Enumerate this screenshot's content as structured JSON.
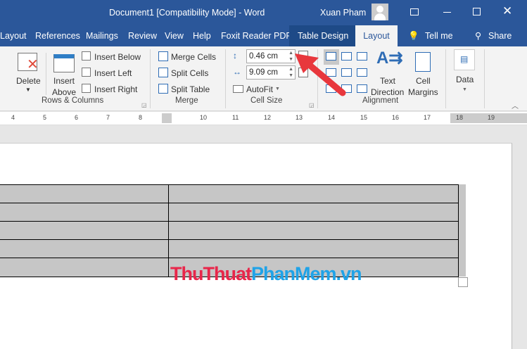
{
  "window": {
    "title": "Document1 [Compatibility Mode]  -  Word",
    "user": "Xuan Pham"
  },
  "tabs": [
    "Layout",
    "References",
    "Mailings",
    "Review",
    "View",
    "Help",
    "Foxit Reader PDF",
    "Table Design",
    "Layout",
    "Tell me",
    "Share"
  ],
  "ribbon": {
    "rows_columns": {
      "delete": "Delete",
      "insert_above_1": "Insert",
      "insert_above_2": "Above",
      "insert_below": "Insert Below",
      "insert_left": "Insert Left",
      "insert_right": "Insert Right",
      "label": "Rows & Columns"
    },
    "merge": {
      "merge_cells": "Merge Cells",
      "split_cells": "Split Cells",
      "split_table": "Split Table",
      "label": "Merge"
    },
    "cell_size": {
      "height": "0.46 cm",
      "width": "9.09 cm",
      "autofit": "AutoFit",
      "label": "Cell Size"
    },
    "alignment": {
      "text_direction_1": "Text",
      "text_direction_2": "Direction",
      "cell_margins_1": "Cell",
      "cell_margins_2": "Margins",
      "label": "Alignment"
    },
    "data": {
      "label": "Data"
    }
  },
  "ruler": [
    "4",
    "5",
    "6",
    "7",
    "8",
    "10",
    "11",
    "12",
    "13",
    "14",
    "15",
    "16",
    "17",
    "18",
    "19"
  ],
  "watermark": {
    "part1": "ThuThuat",
    "part2": "PhanMem.vn"
  },
  "colors": {
    "accent": "#2b579a",
    "arrow": "#e8373d"
  }
}
